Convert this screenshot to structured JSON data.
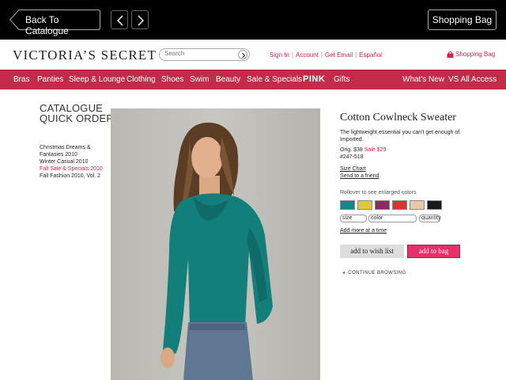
{
  "topbar": {
    "back_label": "Back To Catalogue",
    "bag_label": "Shopping Bag"
  },
  "header": {
    "logo": "VICTORIA’S SECRET",
    "search_placeholder": "Search",
    "links": [
      "Sign In",
      "Account",
      "Get Email",
      "Español"
    ],
    "shopping_bag": "Shopping Bag"
  },
  "nav": {
    "items": [
      "Bras",
      "Panties",
      "Sleep & Lounge",
      "Clothing",
      "Shoes",
      "Swim",
      "Beauty",
      "Sale & Specials",
      "PINK",
      "Gifts",
      "What's New",
      "VS All Access"
    ]
  },
  "catalogue": {
    "title_line1": "CATALOGUE",
    "title_line2": "QUICK ORDER",
    "items": [
      {
        "label": "Christmas Dreams & Fantasies 2010",
        "active": false
      },
      {
        "label": "Winter Casual 2010",
        "active": false
      },
      {
        "label": "Fall Sale & Specials 2010",
        "active": true
      },
      {
        "label": "Fall Fashion 2010, Vol. 2",
        "active": false
      }
    ]
  },
  "product": {
    "name": "Cotton Cowlneck Sweater",
    "description": "The lightweight essential you can't get enough of. Imported.",
    "orig_label": "Orig.",
    "orig_price": "$38",
    "sale_label": "Sale $29",
    "sku": "#247-518",
    "size_chart": "Size Chart",
    "send_friend": "Send to a friend",
    "rollover_text": "Rollover to see enlarged colors",
    "swatches": [
      "#15878a",
      "#d9c93d",
      "#8a2a5f",
      "#d9342b",
      "#e9c8aa",
      "#1a1a1a"
    ],
    "size_label": "size",
    "color_label": "color",
    "quantity_label": "quantity",
    "add_more": "Add more at a time",
    "wish_label": "add to wish list",
    "bag_label": "add to bag",
    "continue_label": "CONTINUE BROWSING"
  },
  "colors": {
    "brand_red": "#c42a4a",
    "sale_pink": "#d2234b",
    "bag_button": "#e6306a"
  }
}
